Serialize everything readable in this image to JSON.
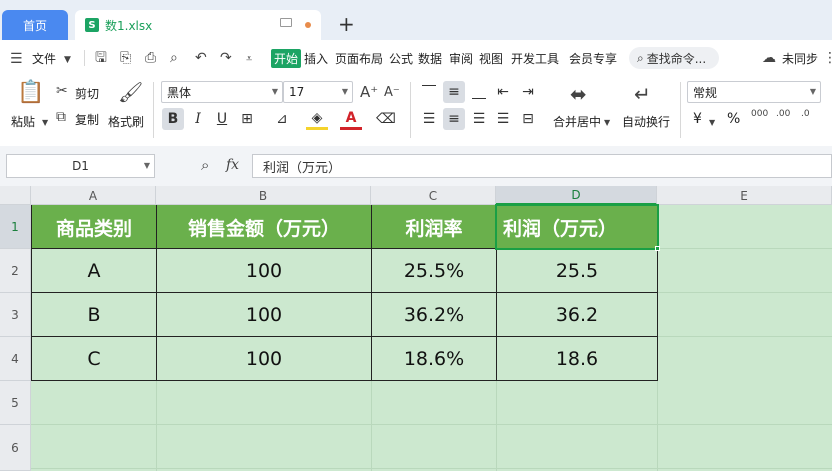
{
  "tabs": {
    "home": "首页",
    "file": "数1.xlsx",
    "new_tab": "+"
  },
  "menu": {
    "file": "文件",
    "items": [
      "开始",
      "插入",
      "页面布局",
      "公式",
      "数据",
      "审阅",
      "视图",
      "开发工具",
      "会员专享"
    ],
    "search": "查找命令...",
    "sync": "未同步"
  },
  "ribbon": {
    "paste": "粘贴",
    "cut": "剪切",
    "copy": "复制",
    "format_painter": "格式刷",
    "font_name": "黑体",
    "font_size": "17",
    "merge_center": "合并居中",
    "wrap_text": "自动换行",
    "number_format": "常规",
    "currency": "¥",
    "percent": "%"
  },
  "formula_bar": {
    "name_box": "D1",
    "fx": "fx",
    "content": "利润（万元）"
  },
  "sheet": {
    "columns": [
      "A",
      "B",
      "C",
      "D",
      "E"
    ],
    "rows": [
      "1",
      "2",
      "3",
      "4",
      "5",
      "6"
    ],
    "headers": [
      "商品类别",
      "销售金额（万元）",
      "利润率",
      "利润（万元）"
    ],
    "data": [
      [
        "A",
        "100",
        "25.5%",
        "25.5"
      ],
      [
        "B",
        "100",
        "36.2%",
        "36.2"
      ],
      [
        "C",
        "100",
        "18.6%",
        "18.6"
      ]
    ],
    "selected_cell": "D1"
  },
  "colors": {
    "header_fill": "#6ab04c",
    "sheet_bg": "#cce8cf",
    "accent": "#1ca464",
    "home_tab": "#4a89f0"
  }
}
